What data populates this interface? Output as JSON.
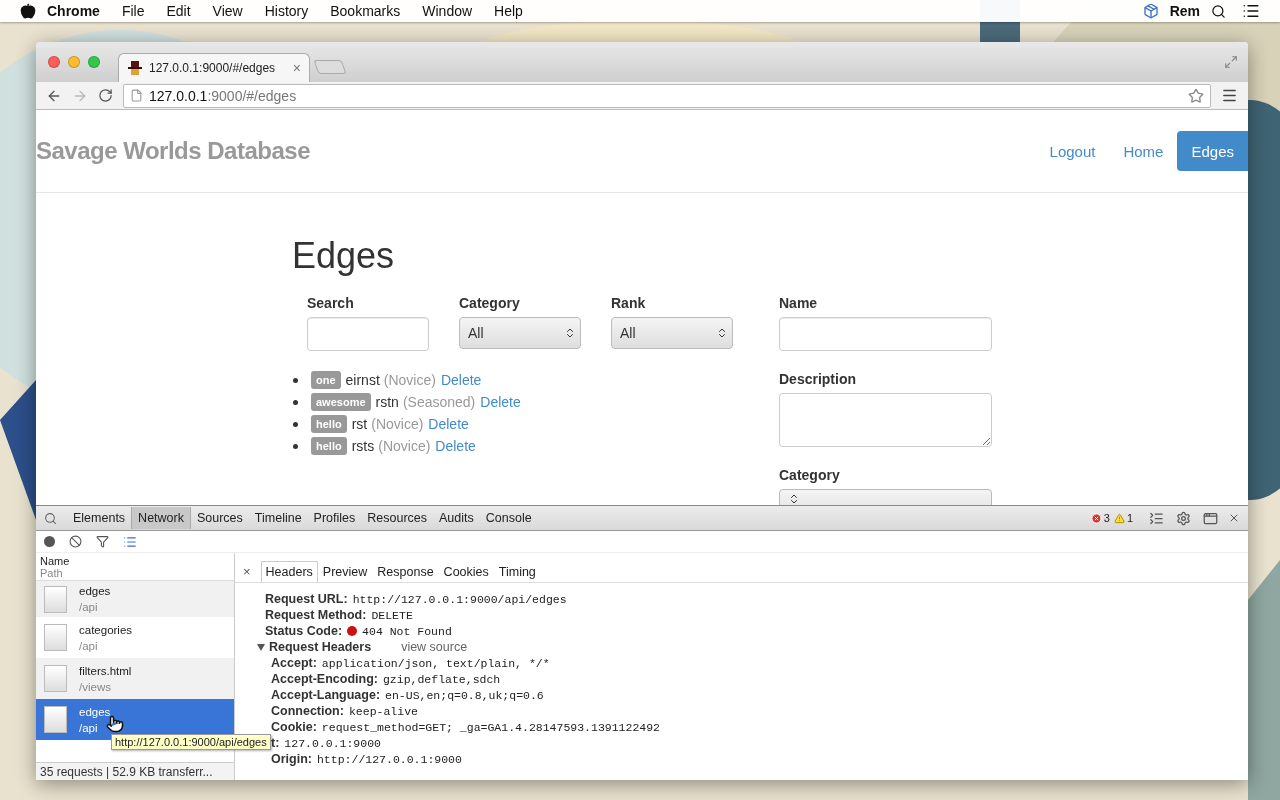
{
  "menubar": {
    "app": "Chrome",
    "items": [
      "File",
      "Edit",
      "View",
      "History",
      "Bookmarks",
      "Window",
      "Help"
    ],
    "user": "Rem"
  },
  "browser": {
    "tab_title": "127.0.0.1:9000/#/edges",
    "tab_close": "×",
    "address_host": "127.0.0.1",
    "address_rest": ":9000/#/edges"
  },
  "page": {
    "brand": "Savage Worlds Database",
    "nav": [
      {
        "label": "Logout",
        "selected": false
      },
      {
        "label": "Home",
        "selected": false
      },
      {
        "label": "Edges",
        "selected": true
      }
    ],
    "heading": "Edges",
    "filters": [
      {
        "label": "Search",
        "kind": "text"
      },
      {
        "label": "Category",
        "kind": "select",
        "value": "All"
      },
      {
        "label": "Rank",
        "kind": "select",
        "value": "All"
      }
    ],
    "edges": [
      {
        "tag": "one",
        "name": "eirnst",
        "rank": "(Novice)",
        "action": "Delete"
      },
      {
        "tag": "awesome",
        "name": "rstn",
        "rank": "(Seasoned)",
        "action": "Delete"
      },
      {
        "tag": "hello",
        "name": "rst",
        "rank": "(Novice)",
        "action": "Delete"
      },
      {
        "tag": "hello",
        "name": "rsts",
        "rank": "(Novice)",
        "action": "Delete"
      }
    ],
    "form": [
      {
        "label": "Name",
        "kind": "text"
      },
      {
        "label": "Description",
        "kind": "textarea"
      },
      {
        "label": "Category",
        "kind": "select"
      }
    ]
  },
  "devtools": {
    "tabs": [
      {
        "label": "Elements",
        "selected": false
      },
      {
        "label": "Network",
        "selected": true
      },
      {
        "label": "Sources",
        "selected": false
      },
      {
        "label": "Timeline",
        "selected": false
      },
      {
        "label": "Profiles",
        "selected": false
      },
      {
        "label": "Resources",
        "selected": false
      },
      {
        "label": "Audits",
        "selected": false
      },
      {
        "label": "Console",
        "selected": false
      }
    ],
    "errors": "3",
    "warnings": "1",
    "list_header": {
      "name": "Name",
      "path": "Path"
    },
    "requests": [
      {
        "name": "edges",
        "path": "/api",
        "selected": false
      },
      {
        "name": "categories",
        "path": "/api",
        "selected": false
      },
      {
        "name": "filters.html",
        "path": "/views",
        "selected": false
      },
      {
        "name": "edges",
        "path": "/api",
        "selected": true
      }
    ],
    "summary": "35 requests | 52.9 KB transferr...",
    "tooltip": "http://127.0.0.1:9000/api/edges",
    "detail_close": "×",
    "detail_tabs": [
      {
        "label": "Headers",
        "selected": true
      },
      {
        "label": "Preview",
        "selected": false
      },
      {
        "label": "Response",
        "selected": false
      },
      {
        "label": "Cookies",
        "selected": false
      },
      {
        "label": "Timing",
        "selected": false
      }
    ],
    "general": [
      {
        "key": "Request URL:",
        "value": "http://127.0.0.1:9000/api/edges",
        "kind": "plain"
      },
      {
        "key": "Request Method:",
        "value": "DELETE",
        "kind": "plain"
      },
      {
        "key": "Status Code:",
        "value": "404 Not Found",
        "kind": "status",
        "color": "#cc1111"
      }
    ],
    "section": {
      "title": "Request Headers",
      "expanded": true,
      "link": "view source"
    },
    "request_headers": [
      {
        "key": "Accept:",
        "value": "application/json, text/plain, */*"
      },
      {
        "key": "Accept-Encoding:",
        "value": "gzip,deflate,sdch"
      },
      {
        "key": "Accept-Language:",
        "value": "en-US,en;q=0.8,uk;q=0.6"
      },
      {
        "key": "Connection:",
        "value": "keep-alive"
      },
      {
        "key": "Cookie:",
        "value": "request_method=GET; _ga=GA1.4.28147593.1391122492"
      },
      {
        "key": "t:",
        "value": "127.0.0.1:9000"
      },
      {
        "key": "Origin:",
        "value": "http://127.0.0.1:9000"
      }
    ]
  }
}
